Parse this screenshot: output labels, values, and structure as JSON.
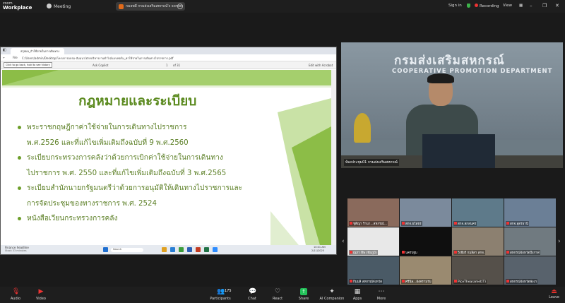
{
  "app": {
    "brand_top": "zoom",
    "brand_bottom": "Workplace",
    "meeting_label": "Meeting"
  },
  "share_pill": {
    "label": "กมลพลี กรมส่งเสริมสหกรณ์'s screen"
  },
  "top_right": {
    "signin": "Sign in",
    "recording": "Recording",
    "view": "View"
  },
  "browser": {
    "tab_title": "สรุปผล_กำใช้จ่ายในการเดินทาง",
    "address_prefix": "File",
    "url": "C:/Users/admin/Desktop/โครงการอบรม-สัมมนา/ฝ่ายบริหารงานทั่วไป/แบบฟอร์ม_ค่าใช้จ่ายในการเดินทางไปราชการ.pdf",
    "tooltip": "Click to go back, hold to see history",
    "pdf_tools": {
      "draw": "Draw",
      "ask_copilot": "Ask Copilot",
      "page_of": "of 31",
      "page": "1",
      "edit_acrobat": "Edit with Acrobat"
    }
  },
  "slide": {
    "title": "กฎหมายและระเบียบ",
    "bullets": [
      {
        "line1": "พระราชกฤษฎีกาค่าใช้จ่ายในการเดินทางไปราชการ",
        "line2": "พ.ศ.2526 และที่แก้ไขเพิ่มเติมถึงฉบับที่ 9 พ.ศ.2560"
      },
      {
        "line1": "ระเบียบกระทรวงการคลังว่าด้วยการเบิกค่าใช้จ่ายในการเดินทาง",
        "line2": "ไปราชการ พ.ศ. 2550 และที่แก้ไขเพิ่มเติมถึงฉบับที่ 3 พ.ศ.2565"
      },
      {
        "line1": "ระเบียบสำนักนายกรัฐมนตรีว่าด้วยการอนุมัติให้เดินทางไปราชการและ",
        "line2": "การจัดประชุมของทางราชการ พ.ศ. 2524"
      },
      {
        "line1": "หนังสือเวียนกระทรวงการคลัง",
        "line2": ""
      }
    ]
  },
  "taskbar": {
    "news": "Finance headline",
    "news_sub": "Stock 33 minutes",
    "time": "10:01 AM",
    "date": "2/11/2025",
    "search": "Search"
  },
  "speaker": {
    "sign_thai": "กรมส่งเสริมสหกรณ์",
    "sign_eng": "COOPERATIVE PROMOTION DEPARTMENT",
    "name": "ห้องประชุม01 กรมส่งเสริมสหกรณ์"
  },
  "gallery": [
    {
      "name": "ชุติญา ร้านา...สหกรณ์...",
      "bg": "#8a6a5c"
    },
    {
      "name": "สกจ.ยโสธร",
      "bg": "#7b8a9c"
    },
    {
      "name": "สกจ.สกลนคร",
      "bg": "#5e7a8a"
    },
    {
      "name": "สกจ.อุดรธานี",
      "bg": "#6b7f96"
    },
    {
      "name": "ณภา ทิพ (ชัยภูมิ)",
      "bg": "#e8e8e8"
    },
    {
      "name": "นครปฐม",
      "bg": "#0f0f0f"
    },
    {
      "name": "วิเชียร์ กมลิสา สกจ.",
      "bg": "#8c8070"
    },
    {
      "name": "สหกรณ์จังหวัดบึงกาฬ",
      "bg": "#707a80"
    },
    {
      "name": "กิมมลิ สหกรณ์จังหวัด",
      "bg": "#4a5a66"
    },
    {
      "name": "ศรีนิล...อังครามรบ",
      "bg": "#9a8a70"
    },
    {
      "name": "PiceThearamet(T)",
      "bg": "#55504a"
    },
    {
      "name": "สหกรณ์จังหวัดพังงา",
      "bg": "#58626c"
    }
  ],
  "bottom": {
    "audio": "Audio",
    "video": "Video",
    "participants": "Participants",
    "participants_count": "175",
    "chat": "Chat",
    "react": "React",
    "share": "Share",
    "ai": "AI Companion",
    "apps": "Apps",
    "more": "More",
    "leave": "Leave"
  },
  "colors": {
    "accent_green": "#5b8a1f",
    "band_green": "#a5cf6d",
    "share_green": "#23c25a",
    "leave_red": "#e0302a"
  }
}
